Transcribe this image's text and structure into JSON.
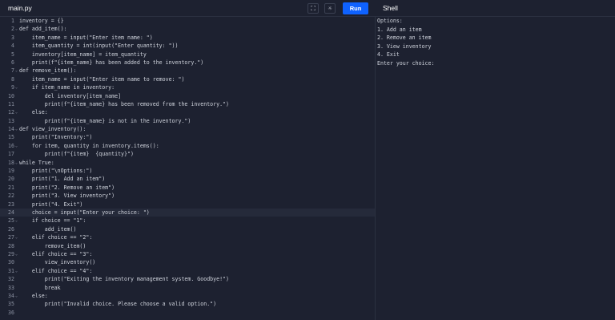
{
  "tabs": {
    "file": "main.py",
    "shell": "Shell"
  },
  "toolbar": {
    "run_label": "Run",
    "fullscreen_icon": "⛶",
    "theme_icon": "☼"
  },
  "editor": {
    "active_line": 24,
    "lines": [
      "inventory = {}",
      "def add_item():",
      "    item_name = input(\"Enter item name: \")",
      "    item_quantity = int(input(\"Enter quantity: \"))",
      "    inventory[item_name] = item_quantity",
      "    print(f\"{item_name} has been added to the inventory.\")",
      "def remove_item():",
      "    item_name = input(\"Enter item name to remove: \")",
      "    if item_name in inventory:",
      "        del inventory[item_name]",
      "        print(f\"{item_name} has been removed from the inventory.\")",
      "    else:",
      "        print(f\"{item_name} is not in the inventory.\")",
      "def view_inventory():",
      "    print(\"Inventory:\")",
      "    for item, quantity in inventory.items():",
      "        print(f\"{item}  {quantity}\")",
      "while True:",
      "    print(\"\\nOptions:\")",
      "    print(\"1. Add an item\")",
      "    print(\"2. Remove an item\")",
      "    print(\"3. View inventory\")",
      "    print(\"4. Exit\")",
      "    choice = input(\"Enter your choice: \")",
      "    if choice == \"1\":",
      "        add_item()",
      "    elif choice == \"2\":",
      "        remove_item()",
      "    elif choice == \"3\":",
      "        view_inventory()",
      "    elif choice == \"4\":",
      "        print(\"Exiting the inventory management system. Goodbye!\")",
      "        break",
      "    else:",
      "        print(\"Invalid choice. Please choose a valid option.\")",
      ""
    ],
    "fold_lines": [
      2,
      7,
      9,
      12,
      14,
      16,
      18,
      25,
      27,
      29,
      31,
      34
    ]
  },
  "shell": {
    "lines": [
      "Options:",
      "1. Add an item",
      "2. Remove an item",
      "3. View inventory",
      "4. Exit",
      "Enter your choice: "
    ]
  }
}
